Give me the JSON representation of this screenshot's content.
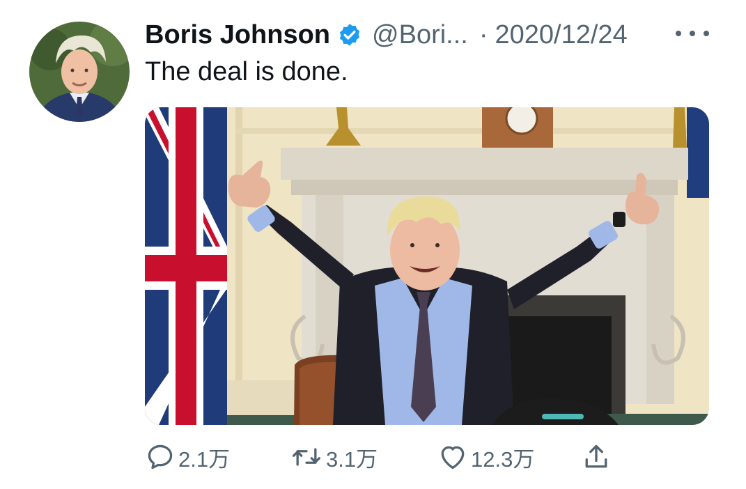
{
  "tweet": {
    "author_name": "Boris Johnson",
    "handle": "@Bori...",
    "separator": "·",
    "date": "2020/12/24",
    "text": "The deal is done.",
    "verified": true
  },
  "actions": {
    "reply_count": "2.1万",
    "retweet_count": "3.1万",
    "like_count": "12.3万"
  },
  "icons": {
    "verified": "verified-badge-icon",
    "more": "more-options-icon",
    "reply": "reply-icon",
    "retweet": "retweet-icon",
    "like": "heart-icon",
    "share": "share-icon"
  },
  "colors": {
    "text": "#0f1419",
    "secondary": "#536471",
    "verified": "#1d9bf0"
  }
}
